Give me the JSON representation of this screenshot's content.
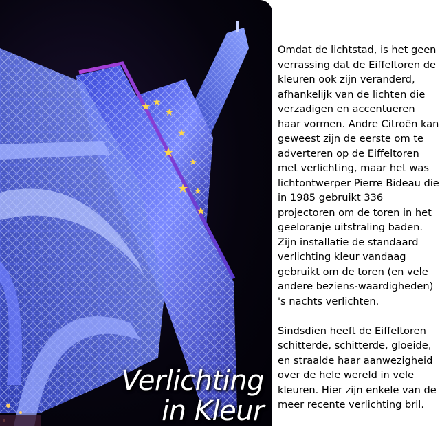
{
  "caption": {
    "line1": "Verlichting",
    "line2": "in Kleur"
  },
  "article": {
    "paragraphs": [
      "Omdat de lichtstad, is het geen verrassing dat de Eiffeltoren de kleuren ook zijn veranderd, afhankelijk van de lichten die verzadigen en accentueren haar vormen. Andre Citroën kan geweest zijn de eerste om te adverteren op de Eiffeltoren met verlichting, maar het was lichtontwerper Pierre Bideau die in 1985 gebruikt 336 projectoren om de toren in het geeloranje uitstraling baden. Zijn installatie de standaard verlichting kleur vandaag gebruikt om de toren (en vele andere beziens-waardigheden) 's nachts verlichten.",
      "Sindsdien heeft de Eiffeltoren schitterde, schitterde, gloeide, en straalde haar aanwezigheid over de hele wereld in vele kleuren. Hier zijn enkele van de meer recente verlichting bril."
    ]
  },
  "colors": {
    "tower_blue": "#5a6cff",
    "tower_glow": "#9db0ff",
    "star_gold": "#ffd84a",
    "night": "#06040e"
  }
}
